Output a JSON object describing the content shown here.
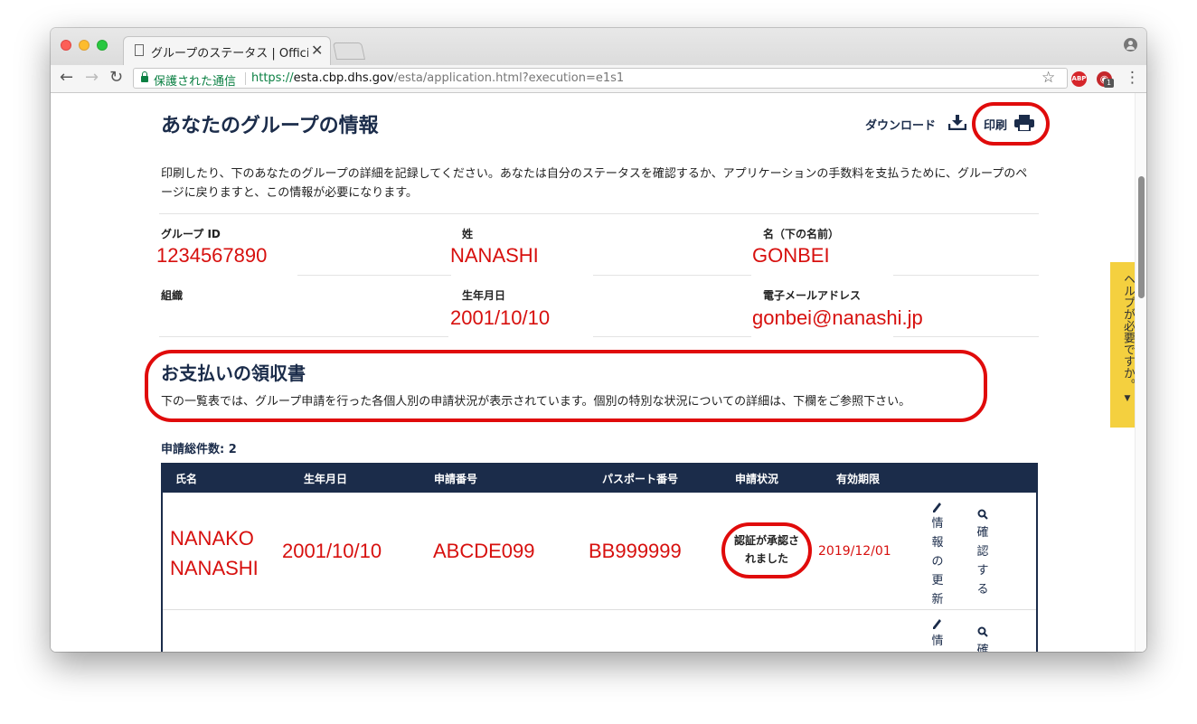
{
  "browser": {
    "tab_title": "グループのステータス | Official",
    "tab_close": "✕",
    "secure_label": "保護された通信",
    "url": {
      "scheme": "https://",
      "host": "esta.cbp.dhs.gov",
      "path": "/esta/application.html?execution=e1s1"
    },
    "abp_label": "ABP",
    "ghost_badge": "1"
  },
  "page": {
    "title": "あなたのグループの情報",
    "download_label": "ダウンロード",
    "print_label": "印刷",
    "intro": "印刷したり、下のあなたのグループの詳細を記録してください。あなたは自分のステータスを確認するか、アプリケーションの手数料を支払うために、グループのページに戻りますと、この情報が必要になります。",
    "fields": {
      "group_id_label": "グループ ID",
      "group_id_value": "1234567890",
      "surname_label": "姓",
      "surname_value": "NANASHI",
      "given_label": "名（下の名前）",
      "given_value": "GONBEI",
      "org_label": "組織",
      "dob_label": "生年月日",
      "dob_value": "2001/10/10",
      "email_label": "電子メールアドレス",
      "email_value": "gonbei@nanashi.jp"
    },
    "receipt_title": "お支払いの領収書",
    "receipt_desc": "下の一覧表では、グループ申請を行った各個人別の申請状況が表示されています。個別の特別な状況についての詳細は、下欄をご参照下さい。",
    "total_label": "申請総件数: 2",
    "help_label": "ヘルプが必要ですか。",
    "help_arrow": "▼"
  },
  "table": {
    "headers": [
      "氏名",
      "生年月日",
      "申請番号",
      "パスポート番号",
      "申請状況",
      "有効期限"
    ],
    "rows": [
      {
        "name": "NANAKO NANASHI",
        "dob": "2001/10/10",
        "app_no": "ABCDE099",
        "passport": "BB999999",
        "status": "認証が承認されました",
        "expiry": "2019/12/01",
        "action_update": "情報の更新",
        "action_check": "確認する"
      },
      {
        "action_update": "情",
        "action_check": "確"
      }
    ]
  },
  "colors": {
    "navy": "#1b2c4a",
    "annotation_red": "#e00b0b",
    "value_red": "#d7100e",
    "help_yellow": "#f4d03f"
  }
}
